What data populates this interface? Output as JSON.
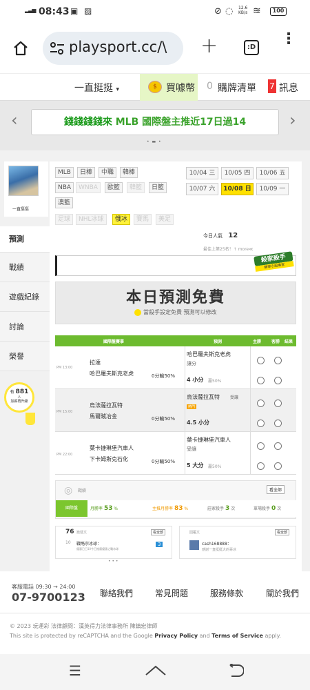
{
  "status": {
    "time": "08:43",
    "speed": "12.6\nKB/s",
    "battery": "100"
  },
  "browser": {
    "url": "playsport.cc/\\",
    "tab_count": ":D"
  },
  "nav": {
    "menu": "一直挺挺",
    "coin_label": "買噱幣",
    "cart_count": "0",
    "cart_label": "購牌清單",
    "msg_count": "7",
    "msg_label": "訊息"
  },
  "banner": {
    "pre": "錢錢錢錢來",
    "rest": "MLB 國際盤主推近17日過14"
  },
  "user": {
    "name": "一直挺挺"
  },
  "sports": {
    "row1": [
      "MLB",
      "日棒",
      "中職",
      "韓棒"
    ],
    "row2": [
      "NBA",
      "WNBA",
      "歐籃",
      "韓籃",
      "日籃"
    ],
    "row3": [
      "澳籃"
    ],
    "row4": [
      "足球",
      "NHL冰球",
      "俄冰",
      "賽馬",
      "美足"
    ]
  },
  "dates": [
    {
      "d": "10/04",
      "w": "三"
    },
    {
      "d": "10/05",
      "w": "四"
    },
    {
      "d": "10/06",
      "w": "五"
    },
    {
      "d": "10/07",
      "w": "六"
    },
    {
      "d": "10/08",
      "w": "日"
    },
    {
      "d": "10/09",
      "w": "一"
    }
  ],
  "today": {
    "label": "今日人氣",
    "value": "12",
    "note": "最佳上第25名！↑ more≪"
  },
  "sidebar": [
    "預測",
    "戰績",
    "遊戲紀錄",
    "討論",
    "榮譽"
  ],
  "tip": {
    "pre": "有",
    "count": "881",
    "post": "人\n加薪再升級"
  },
  "badge": {
    "main": "殺家殺手",
    "sub": "勝率小組專家"
  },
  "free": {
    "title": "本日預測免費",
    "sub": "當殺手設定免費 預測可以修改"
  },
  "table": {
    "headers": [
      "國際盤賽事",
      "預測",
      "主勝",
      "客勝",
      "結果"
    ],
    "games": [
      {
        "time": "PM 13:00",
        "team1": "拉達",
        "team2": "哈巴羅夫斯克老虎",
        "pct1": "0分輸50%",
        "pick1": "哈巴羅夫斯克老虎",
        "pick1sub": "讓分",
        "pick2": "4 小分",
        "pick2sub": "贏50%"
      },
      {
        "time": "PM 15:00",
        "team1": "烏法薩拉瓦特",
        "team2": "馬爾賊冶金",
        "pct1": "0分輸50%",
        "pick1": "烏法薩拉瓦特",
        "pick1sub": "受讓",
        "pick1tag": "熱門",
        "pick2": "4.5 小分",
        "pick2sub": ""
      },
      {
        "time": "PM 22:00",
        "team1": "葉卡捷琳堡汽車人",
        "team2": "下卡姆斯克石化",
        "pct1": "0分輸50%",
        "pick1": "葉卡捷琳堡汽車人",
        "pick1sub": "受讓",
        "pick2": "5 大分",
        "pick2sub": "贏50%"
      }
    ]
  },
  "record": {
    "label": "戰績",
    "more": "看全部",
    "stats": [
      {
        "k": "國際盤",
        "v": ""
      },
      {
        "k": "月勝率",
        "v": "53",
        "u": "%"
      },
      {
        "k": "主推月勝率",
        "v": "83",
        "u": "%"
      },
      {
        "k": "莊家殺手",
        "v": "3",
        "u": "次"
      },
      {
        "k": "單場殺手",
        "v": "0",
        "u": "次"
      }
    ]
  },
  "discuss": {
    "count": "76",
    "count_label": "篇發文",
    "more": "看全部",
    "item_num": "10",
    "item_title": "戰略宗冰球：",
    "item_sub": "優惠已日10今日推廣優惠之戰冰球",
    "item_badge": "3"
  },
  "reply": {
    "label": "回覆文",
    "more": "看全部",
    "user": "cash168888：",
    "text": "感謝一直挺挺大的哥冰"
  },
  "footer": {
    "phone_label": "客服電話 09:30 → 24:00",
    "phone": "07-9700123",
    "links": [
      "聯絡我們",
      "常見問題",
      "服務條款",
      "關於我們"
    ],
    "copyright": "© 2023 玩運彩 法律顧問：漢英得力法律事務所 陳鎮宏律師",
    "recaptcha_pre": "This site is protected by reCAPTCHA and the Google",
    "privacy": "Privacy Policy",
    "and": "and",
    "terms": "Terms of Service",
    "apply": "apply."
  }
}
